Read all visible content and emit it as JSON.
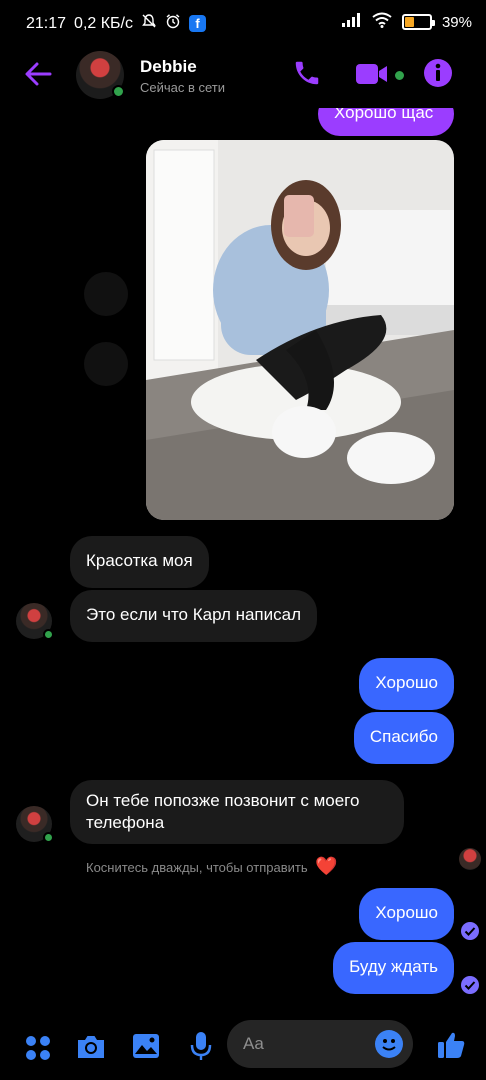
{
  "status_bar": {
    "time": "21:17",
    "net_speed": "0,2 КБ/с",
    "battery": "39%",
    "battery_level": 0.39
  },
  "header": {
    "contact_name": "Debbie",
    "status": "Сейчас в сети"
  },
  "messages": {
    "top_partial": "Хорошо щас",
    "incoming_1": "Красотка моя",
    "incoming_2": "Это если что Карл написал",
    "outgoing_1": "Хорошо",
    "outgoing_2": "Спасибо",
    "incoming_3": "Он тебе попозже позвонит с моего телефона",
    "outgoing_3": "Хорошо",
    "outgoing_4": "Буду ждать"
  },
  "hint": {
    "text": "Коснитесь дважды, чтобы отправить",
    "emoji": "❤️"
  },
  "composer": {
    "placeholder": "Aa"
  },
  "colors": {
    "accent": "#9b3dff",
    "outgoing": "#3967ff",
    "incoming": "#1b1b1b",
    "online": "#31a24c"
  }
}
